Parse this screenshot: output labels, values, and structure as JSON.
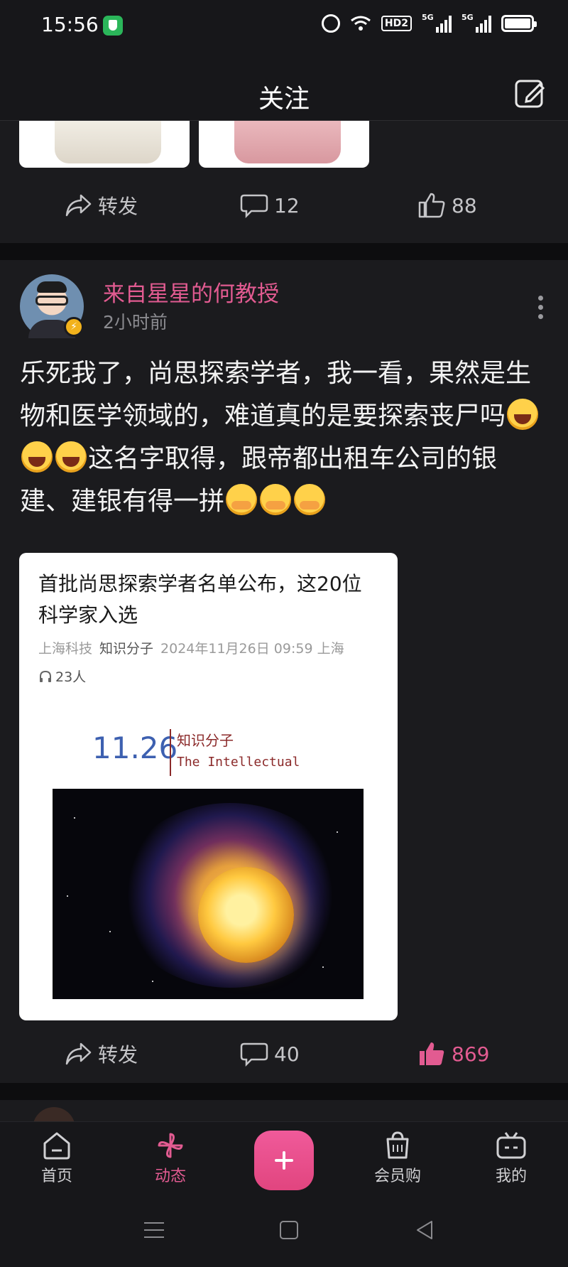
{
  "status_bar": {
    "time": "15:56",
    "hd_label": "HD2",
    "net1": "5G",
    "net2": "5G"
  },
  "header": {
    "title": "关注"
  },
  "prev_post": {
    "forward_label": "转发",
    "comment_count": "12",
    "like_count": "88"
  },
  "post": {
    "username": "来自星星的何教授",
    "time": "2小时前",
    "text_1": "乐死我了，尚思探索学者，我一看，果然是生物和医学领域的，难道真的是要探索丧尸吗",
    "text_2": "这名字取得，跟帝都出租车公司的银建、建银有得一拼",
    "article": {
      "title": "首批尚思探索学者名单公布，这20位科学家入选",
      "meta_publisher": "上海科技",
      "meta_source": "知识分子",
      "meta_datetime": "2024年11月26日 09:59",
      "meta_location": "上海",
      "listeners": "23人",
      "brand_date": "11.26",
      "brand_cn": "知识分子",
      "brand_en": "The Intellectual"
    },
    "forward_label": "转发",
    "comment_count": "40",
    "like_count": "869"
  },
  "bottom_nav": {
    "home": "首页",
    "dynamic": "动态",
    "shop": "会员购",
    "me": "我的"
  },
  "colors": {
    "accent": "#e25b91",
    "background": "#17171a",
    "card": "#1b1b1e"
  }
}
